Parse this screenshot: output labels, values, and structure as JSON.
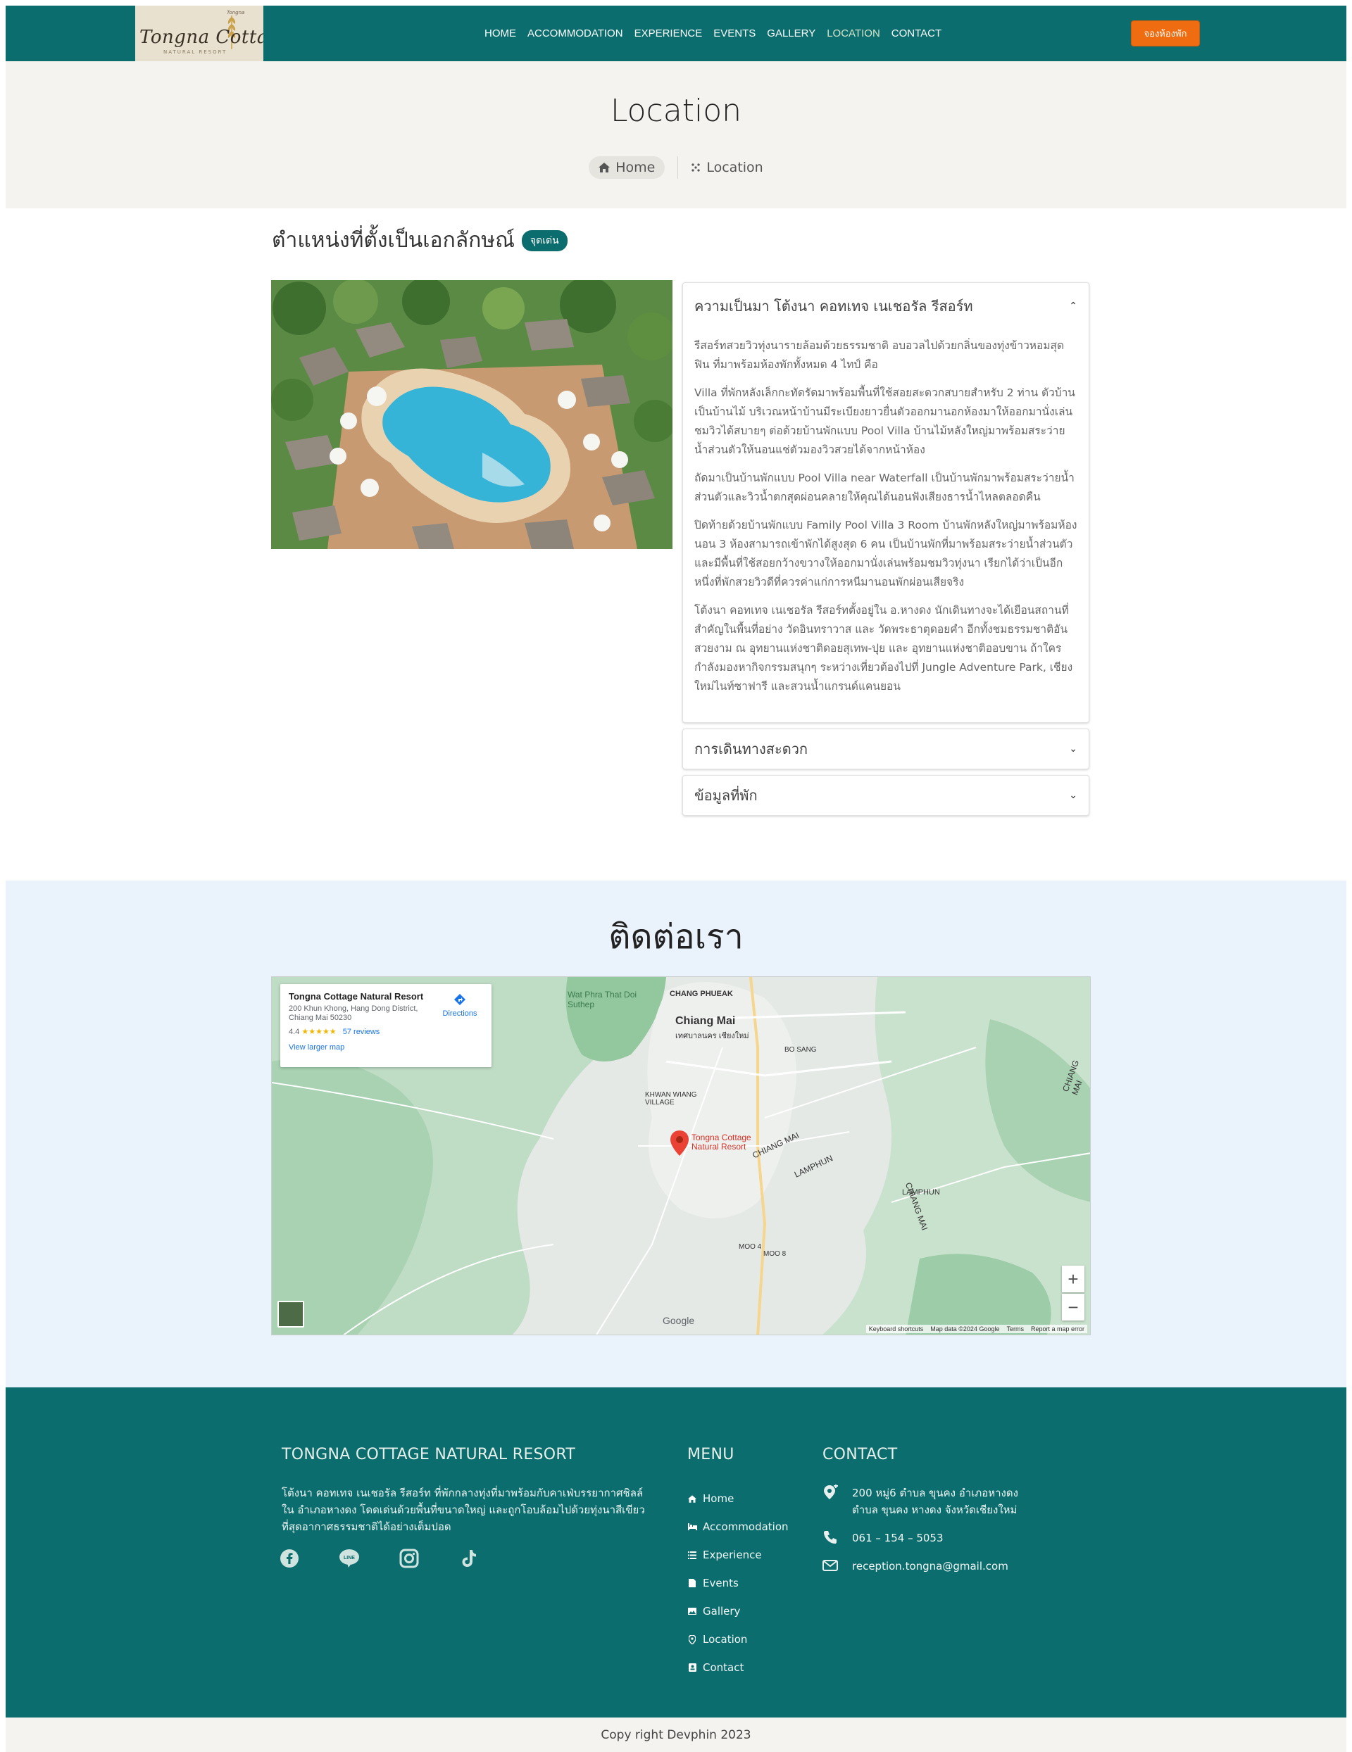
{
  "brand": {
    "logo_script": "Tongna Cottage",
    "logo_top": "Tongna",
    "logo_sub": "NATURAL RESORT",
    "primary_color": "#0b6d6e",
    "accent_color": "#ef6c10"
  },
  "nav": {
    "items": [
      {
        "label": "HOME"
      },
      {
        "label": "ACCOMMODATION"
      },
      {
        "label": "EXPERIENCE"
      },
      {
        "label": "EVENTS"
      },
      {
        "label": "GALLERY"
      },
      {
        "label": "LOCATION"
      },
      {
        "label": "CONTACT"
      }
    ],
    "active": "LOCATION",
    "book_button": "จองห้องพัก"
  },
  "hero": {
    "title": "Location",
    "breadcrumb_home": "Home",
    "breadcrumb_current": "Location"
  },
  "location": {
    "heading": "ตำแหน่งที่ตั้งเป็นเอกลักษณ์",
    "badge": "จุดเด่น",
    "accordion": [
      {
        "title": "ความเป็นมา โต้งนา คอทเทจ เนเชอรัล รีสอร์ท",
        "open": true,
        "paragraphs": [
          "รีสอร์ทสวยวิวทุ่งนารายล้อมด้วยธรรมชาติ อบอวลไปด้วยกลิ่นของทุ่งข้าวหอมสุดฟิน ที่มาพร้อมห้องพักทั้งหมด 4 ไทป์ คือ",
          "Villa ที่พักหลังเล็กกะทัดรัดมาพร้อมพื้นที่ใช้สอยสะดวกสบายสำหรับ 2 ท่าน ตัวบ้านเป็นบ้านไม้ บริเวณหน้าบ้านมีระเบียงยาวยื่นตัวออกมานอกห้องมาให้ออกมานั่งเล่นชมวิวได้สบายๆ ต่อด้วยบ้านพักแบบ Pool Villa บ้านไม้หลังใหญ่มาพร้อมสระว่ายน้ำส่วนตัวให้นอนแช่ตัวมองวิวสวยได้จากหน้าห้อง",
          "ถัดมาเป็นบ้านพักแบบ Pool Villa near Waterfall เป็นบ้านพักมาพร้อมสระว่ายน้ำส่วนตัวและวิวน้ำตกสุดผ่อนคลายให้คุณได้นอนฟังเสียงธารน้ำไหลตลอดคืน",
          "ปิดท้ายด้วยบ้านพักแบบ Family Pool Villa 3 Room บ้านพักหลังใหญ่มาพร้อมห้องนอน 3 ห้องสามารถเข้าพักได้สูงสุด 6 คน เป็นบ้านพักที่มาพร้อมสระว่ายน้ำส่วนตัวและมีพื้นที่ใช้สอยกว้างขวางให้ออกมานั่งเล่นพร้อมชมวิวทุ่งนา เรียกได้ว่าเป็นอีกหนึ่งที่พักสวยวิวดีที่ควรค่าแก่การหนีมานอนพักผ่อนเสียจริง",
          "โต้งนา คอทเทจ เนเชอรัล รีสอร์ทตั้งอยู่ใน อ.หางดง นักเดินทางจะได้เยือนสถานที่สำคัญในพื้นที่อย่าง วัดอินทราวาส และ วัดพระธาตุดอยคำ อีกทั้งชมธรรมชาติอันสวยงาม ณ อุทยานแห่งชาติดอยสุเทพ-ปุย และ อุทยานแห่งชาติออบขาน ถ้าใครกำลังมองหากิจกรรมสนุกๆ ระหว่างเที่ยวต้องไปที่ Jungle Adventure Park, เชียงใหม่ไนท์ซาฟารี และสวนน้ำแกรนด์แคนยอน"
        ]
      },
      {
        "title": "การเดินทางสะดวก",
        "open": false
      },
      {
        "title": "ข้อมูลที่พัก",
        "open": false
      }
    ]
  },
  "contact": {
    "title": "ติดต่อเรา",
    "map": {
      "place_name": "Tongna Cottage Natural Resort",
      "address": "200 Khun Khong, Hang Dong District, Chiang Mai 50230",
      "rating": "4.4",
      "stars": "★★★★★",
      "reviews": "57 reviews",
      "directions": "Directions",
      "view_larger": "View larger map",
      "pin_label_1": "Tongna Cottage",
      "pin_label_2": "Natural Resort",
      "zoom_in": "+",
      "zoom_out": "−",
      "footer_links": [
        "Keyboard shortcuts",
        "Map data ©2024 Google",
        "Terms",
        "Report a map error"
      ],
      "google": "Google",
      "labels": {
        "chiang_mai": "Chiang Mai",
        "chiang_mai_th": "เทศบาลนคร เชียงใหม่",
        "chang_phueak": "CHANG PHUEAK",
        "wat_phra_that": "Wat Phra That Doi Suthep",
        "bo_sang": "BO SANG",
        "khwan_wiang": "KHWAN WIANG VILLAGE",
        "lamphun": "LAMPHUN",
        "chiang_mai_road": "CHIANG MAI",
        "chiang_mai_road2": "CHIANG MAI",
        "lamphun_road": "LAMPHUN",
        "chiang_mai_edge": "CHIANG MAI",
        "moo_4": "MOO 4",
        "moo_8": "MOO 8"
      }
    }
  },
  "footer": {
    "resort_title": "TONGNA COTTAGE NATURAL RESORT",
    "about": "โต้งนา คอทเทจ เนเชอรัล รีสอร์ท ที่พักกลางทุ่งที่มาพร้อมกับคาเฟ่บรรยากาศชิลล์ใน อำเภอหางดง โดดเด่นด้วยพื้นที่ขนาดใหญ่ และถูกโอบล้อมไปด้วยทุ่งนาสีเขียว ที่สุดอากาศธรรมชาติได้อย่างเต็มปอด",
    "menu_title": "MENU",
    "menu": [
      {
        "label": "Home",
        "icon": "home-icon"
      },
      {
        "label": "Accommodation",
        "icon": "bed-icon"
      },
      {
        "label": "Experience",
        "icon": "list-icon"
      },
      {
        "label": "Events",
        "icon": "file-icon"
      },
      {
        "label": "Gallery",
        "icon": "image-icon"
      },
      {
        "label": "Location",
        "icon": "map-pin-icon"
      },
      {
        "label": "Contact",
        "icon": "contact-card-icon"
      }
    ],
    "contact_title": "CONTACT",
    "address": "200 หมู่6 ตำบล ขุนคง อำเภอหางดง ตำบล ขุนคง หางดง จังหวัดเชียงใหม่",
    "phone": "061 – 154 – 5053",
    "email": "reception.tongna@gmail.com",
    "socials": [
      "facebook-icon",
      "line-icon",
      "instagram-icon",
      "tiktok-icon"
    ]
  },
  "copyright": "Copy right Devphin 2023"
}
